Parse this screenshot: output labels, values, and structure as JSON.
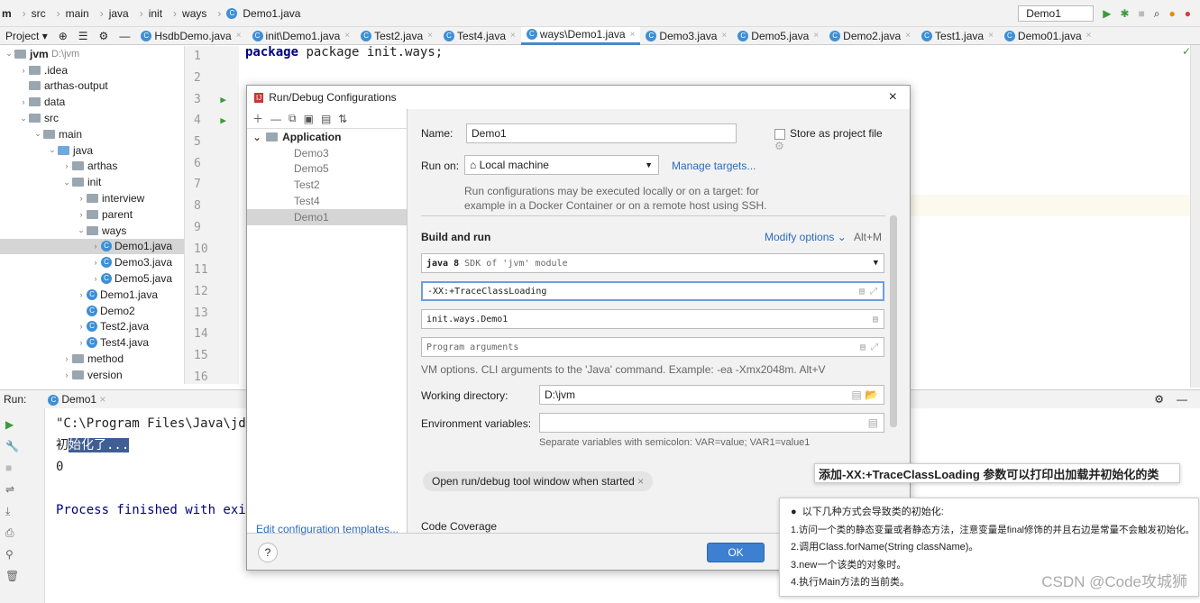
{
  "breadcrumb": [
    "m",
    "src",
    "main",
    "java",
    "init",
    "ways",
    "Demo1.java"
  ],
  "toolbar": {
    "run_config": "Demo1"
  },
  "tabs_bar": {
    "project_label": "Project"
  },
  "tabs": [
    {
      "label": "HsdbDemo.java"
    },
    {
      "label": "init\\Demo1.java"
    },
    {
      "label": "Test2.java"
    },
    {
      "label": "Test4.java"
    },
    {
      "label": "ways\\Demo1.java",
      "active": true
    },
    {
      "label": "Demo3.java"
    },
    {
      "label": "Demo5.java"
    },
    {
      "label": "Demo2.java"
    },
    {
      "label": "Test1.java"
    },
    {
      "label": "Demo01.java"
    }
  ],
  "tree": [
    {
      "d": 0,
      "a": "⌄",
      "t": "jvm",
      "s": "D:\\jvm"
    },
    {
      "d": 1,
      "a": "›",
      "t": ".idea"
    },
    {
      "d": 1,
      "a": "",
      "t": "arthas-output"
    },
    {
      "d": 1,
      "a": "›",
      "t": "data"
    },
    {
      "d": 1,
      "a": "⌄",
      "t": "src"
    },
    {
      "d": 2,
      "a": "⌄",
      "t": "main"
    },
    {
      "d": 3,
      "a": "⌄",
      "t": "java",
      "b": 1
    },
    {
      "d": 4,
      "a": "›",
      "t": "arthas"
    },
    {
      "d": 4,
      "a": "⌄",
      "t": "init"
    },
    {
      "d": 5,
      "a": "›",
      "t": "interview"
    },
    {
      "d": 5,
      "a": "›",
      "t": "parent"
    },
    {
      "d": 5,
      "a": "⌄",
      "t": "ways"
    },
    {
      "d": 6,
      "a": "›",
      "t": "Demo1.java",
      "c": 1,
      "sel": 1
    },
    {
      "d": 6,
      "a": "›",
      "t": "Demo3.java",
      "c": 1
    },
    {
      "d": 6,
      "a": "›",
      "t": "Demo5.java",
      "c": 1
    },
    {
      "d": 5,
      "a": "›",
      "t": "Demo1.java",
      "c": 1
    },
    {
      "d": 5,
      "a": "",
      "t": "Demo2",
      "c": 1
    },
    {
      "d": 5,
      "a": "›",
      "t": "Test2.java",
      "c": 1
    },
    {
      "d": 5,
      "a": "›",
      "t": "Test4.java",
      "c": 1
    },
    {
      "d": 4,
      "a": "›",
      "t": "method"
    },
    {
      "d": 4,
      "a": "›",
      "t": "version"
    }
  ],
  "editor": {
    "lines": [
      "1",
      "2",
      "3",
      "4",
      "5",
      "6",
      "7",
      "8",
      "9",
      "10",
      "11",
      "12",
      "13",
      "14",
      "15",
      "16"
    ],
    "code": "package init.ways;"
  },
  "run": {
    "label": "Run:",
    "tab": "Demo1",
    "console": [
      "\"C:\\Program Files\\Java\\jd",
      "初",
      "始化了...",
      "0",
      "",
      "Process finished with exi"
    ]
  },
  "dialog": {
    "title": "Run/Debug Configurations",
    "tree_root": "Application",
    "items": [
      "Demo3",
      "Demo5",
      "Test2",
      "Test4",
      "Demo1"
    ],
    "edit_templates": "Edit configuration templates...",
    "name_label": "Name:",
    "name_value": "Demo1",
    "store_label": "Store as project file",
    "run_on_label": "Run on:",
    "run_on_value": "Local machine",
    "manage_targets": "Manage targets...",
    "run_on_hint1": "Run configurations may be executed locally or on a target: for",
    "run_on_hint2": "example in a Docker Container or on a remote host using SSH.",
    "build_run": "Build and run",
    "modify_options": "Modify options",
    "modify_shortcut": "Alt+M",
    "sdk_bold": "java 8",
    "sdk_hint": "SDK of 'jvm' module",
    "vm_options": "-XX:+TraceClassLoading",
    "main_class": "init.ways.Demo1",
    "program_args_placeholder": "Program arguments",
    "vm_hint": "VM options. CLI arguments to the 'Java' command. Example: -ea -Xmx2048m. Alt+V",
    "workdir_label": "Working directory:",
    "workdir_value": "D:\\jvm",
    "env_label": "Environment variables:",
    "env_value": "",
    "env_hint": "Separate variables with semicolon: VAR=value; VAR1=value1",
    "chip": "Open run/debug tool window when started",
    "code_coverage": "Code Coverage",
    "ok": "OK",
    "help": "?"
  },
  "annotation": {
    "title": "添加-XX:+TraceClassLoading 参数可以打印出加载并初始化的类",
    "lines": [
      "以下几种方式会导致类的初始化:",
      "1.访问一个类的静态变量或者静态方法，注意变量是final修饰的并且右边是常量不会触发初始化。",
      "2.调用Class.forName(String className)。",
      "3.new一个该类的对象时。",
      "4.执行Main方法的当前类。"
    ],
    "watermark": "CSDN @Code攻城狮"
  },
  "colors": {
    "accent": "#4a88c7",
    "selection": "#3f5e93",
    "run_green": "#3c9a3c"
  }
}
